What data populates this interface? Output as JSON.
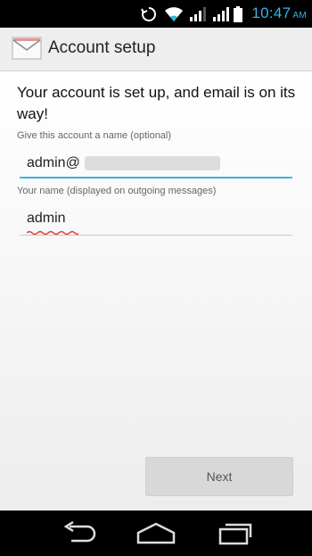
{
  "status_bar": {
    "time": "10:47",
    "ampm": "AM",
    "icons": [
      "sync-icon",
      "wifi-icon",
      "signal-icon",
      "signal-icon",
      "battery-icon"
    ]
  },
  "action_bar": {
    "title": "Account setup",
    "icon": "email-icon"
  },
  "main": {
    "headline": "Your account is set up, and email is on its way!",
    "account_name": {
      "label": "Give this account a name (optional)",
      "value": "admin@"
    },
    "your_name": {
      "label": "Your name (displayed on outgoing messages)",
      "value": "admin"
    },
    "next_label": "Next"
  },
  "nav_bar": {
    "buttons": [
      "back-icon",
      "home-icon",
      "recent-apps-icon"
    ]
  },
  "colors": {
    "accent": "#33b5e5",
    "status_bar": "#000000",
    "action_bar": "#eeeeee"
  }
}
